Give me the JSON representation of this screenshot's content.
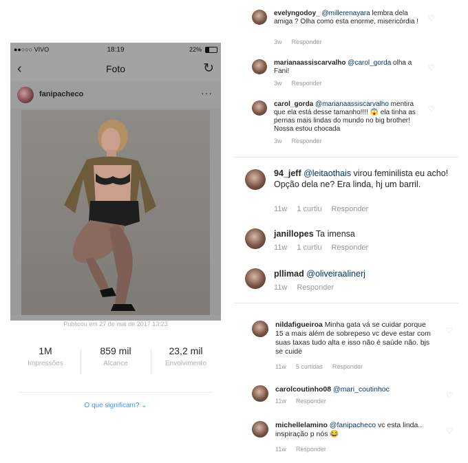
{
  "phone": {
    "status": {
      "carrier": "●●○○○ VIVO",
      "time": "18:19",
      "battery": "22%"
    },
    "nav": {
      "back": "‹",
      "title": "Foto",
      "refresh": "↻"
    },
    "post": {
      "username": "fanipacheco",
      "more": "···"
    },
    "published": "Publicou em 27 de mai de 2017 13:23",
    "stats": [
      {
        "value": "1M",
        "label": "Impressões"
      },
      {
        "value": "859 mil",
        "label": "Alcance"
      },
      {
        "value": "23,2 mil",
        "label": "Envolvimento"
      }
    ],
    "meaning_link": "O que significam? ⌄"
  },
  "comments": [
    {
      "user": "evelyngodoy_",
      "mention": "@millerenayara",
      "text": " lembra dela amiga ? Olha como esta enorme, misericórdia !",
      "time": "3w",
      "reply": "Responder",
      "likes": ""
    },
    {
      "user": "marianaassiscarvalho",
      "mention": "@carol_gorda",
      "text": " olha a Fani!",
      "time": "3w",
      "reply": "Responder",
      "likes": ""
    },
    {
      "user": "carol_gorda",
      "mention": "@marianaassiscarvalho",
      "text": " mentira que ela está desse tamanho!!!! 😱 ela tinha as pernas mais lindas do mundo no big brother! Nossa estou chocada",
      "time": "3w",
      "reply": "Responder",
      "likes": ""
    },
    {
      "user": "94_jeff",
      "mention": "@leitaothais",
      "text": " virou feminilista eu acho! Opção dela ne? Era linda, hj um barril.",
      "time": "11w",
      "reply": "Responder",
      "likes": "1 curtiu"
    },
    {
      "user": "janillopes",
      "mention": "",
      "text": "Ta imensa",
      "time": "11w",
      "reply": "Responder",
      "likes": "1 curtiu"
    },
    {
      "user": "pllimad",
      "mention": "@oliveiraalinerj",
      "text": "",
      "time": "11w",
      "reply": "Responder",
      "likes": ""
    },
    {
      "user": "nildafigueiroa",
      "mention": "",
      "text": "Minha gata vá se cuidar porque 15 a mais além de sobrepeso vc deve estar com suas taxas tudo alta e isso não é saúde não. bjs se cuide",
      "time": "11w",
      "reply": "Responder",
      "likes": "5 curtidas"
    },
    {
      "user": "carolcoutinho08",
      "mention": "@mari_coutinhoc",
      "text": "",
      "time": "11w",
      "reply": "Responder",
      "likes": ""
    },
    {
      "user": "michellelamino",
      "mention": "@fanipacheco",
      "text": " vc esta linda.. inspiração p nós 😂",
      "time": "11w",
      "reply": "Responder",
      "likes": ""
    }
  ],
  "icons": {
    "heart": "heart-outline-icon"
  }
}
